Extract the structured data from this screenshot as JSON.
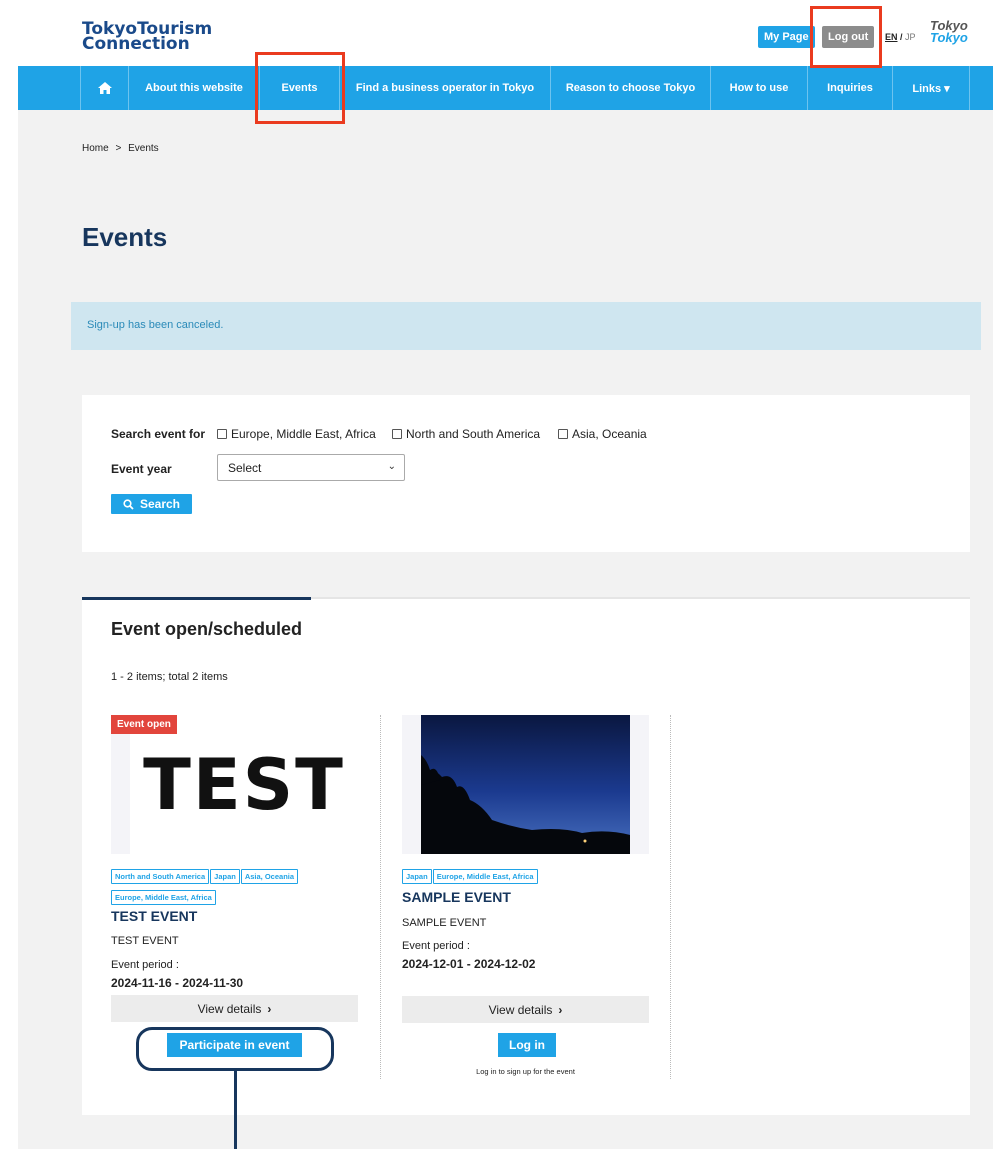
{
  "header": {
    "logo_line1": "TokyoTourism",
    "logo_line2": "Connection",
    "mypage": "My Page",
    "logout": "Log out",
    "lang_en": "EN",
    "lang_sep": " / ",
    "lang_jp": "JP",
    "tokyo_logo_top": "Tokyo",
    "tokyo_logo_bottom": "Tokyo"
  },
  "nav": {
    "home_icon": "home-icon",
    "items": [
      "About this website",
      "Events",
      "Find a business operator in Tokyo",
      "Reason to choose Tokyo",
      "How to use",
      "Inquiries",
      "Links ▾"
    ]
  },
  "breadcrumb": {
    "home": "Home",
    "sep": ">",
    "current": "Events"
  },
  "page_title": "Events",
  "alert": "Sign-up has been canceled.",
  "search": {
    "label": "Search event for",
    "regions": [
      "Europe, Middle East, Africa",
      "North and South America",
      "Asia, Oceania"
    ],
    "year_label": "Event year",
    "year_value": "Select",
    "button": "Search"
  },
  "events": {
    "title": "Event open/scheduled",
    "count": "1 - 2 items; total 2 items",
    "cards": [
      {
        "badge": "Event open",
        "thumb_text": "TEST",
        "tags": [
          "North and South America",
          "Japan",
          "Asia, Oceania",
          "Europe, Middle East, Africa"
        ],
        "title": "TEST EVENT",
        "desc": "TEST EVENT",
        "period_label": "Event period :",
        "period": "2024-11-16 - 2024-11-30",
        "details": "View details",
        "action": "Participate in event"
      },
      {
        "tags": [
          "Japan",
          "Europe, Middle East, Africa"
        ],
        "title": "SAMPLE EVENT",
        "desc": "SAMPLE EVENT",
        "period_label": "Event period :",
        "period": "2024-12-01 - 2024-12-02",
        "details": "View details",
        "action": "Log in",
        "note": "Log in to sign up for the event"
      }
    ]
  },
  "colors": {
    "accent": "#1fa3e6",
    "navy": "#17365d",
    "highlight": "#ea3b1f",
    "badge": "#e2453c"
  }
}
